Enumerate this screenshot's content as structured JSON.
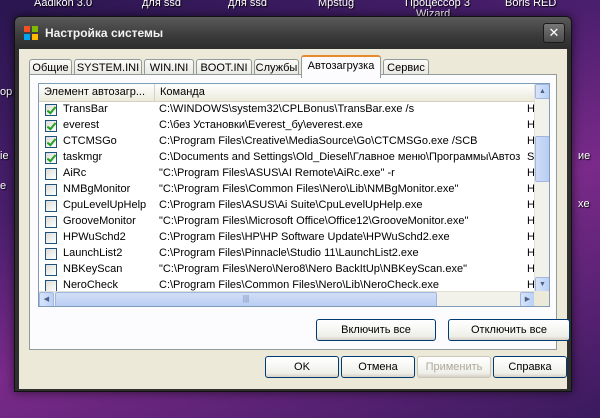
{
  "desktop": {
    "top_labels": [
      "Aadikon 3.0",
      "для ssd",
      "для ssd",
      "Mpstug",
      "Процессор 3",
      "Wizard",
      "Boris RED"
    ],
    "side_labels": [
      "ор",
      "ie",
      "е",
      "ие",
      "xe"
    ]
  },
  "window": {
    "title": "Настройка системы",
    "close_glyph": "✕"
  },
  "tabs": [
    {
      "label": "Общие"
    },
    {
      "label": "SYSTEM.INI"
    },
    {
      "label": "WIN.INI"
    },
    {
      "label": "BOOT.INI"
    },
    {
      "label": "Службы"
    },
    {
      "label": "Автозагрузка",
      "active": true
    },
    {
      "label": "Сервис"
    }
  ],
  "startup_list": {
    "columns": [
      "Элемент автозагр...",
      "Команда"
    ],
    "rows": [
      {
        "checked": true,
        "name": "TransBar",
        "command": "C:\\WINDOWS\\system32\\CPLBonus\\TransBar.exe /s",
        "extra": "H"
      },
      {
        "checked": true,
        "name": "everest",
        "command": "C:\\без Установки\\Everest_бу\\everest.exe",
        "extra": "H"
      },
      {
        "checked": true,
        "name": "CTCMSGo",
        "command": "C:\\Program Files\\Creative\\MediaSource\\Go\\CTCMSGo.exe /SCB",
        "extra": "H"
      },
      {
        "checked": true,
        "name": "taskmgr",
        "command": "C:\\Documents and Settings\\Old_Diesel\\Главное меню\\Программы\\Автоз...",
        "extra": "S"
      },
      {
        "checked": false,
        "name": "AiRc",
        "command": "\"C:\\Program Files\\ASUS\\AI Remote\\AiRc.exe\" -r",
        "extra": "H"
      },
      {
        "checked": false,
        "name": "NMBgMonitor",
        "command": "\"C:\\Program Files\\Common Files\\Nero\\Lib\\NMBgMonitor.exe\"",
        "extra": "H"
      },
      {
        "checked": false,
        "name": "CpuLevelUpHelp",
        "command": "C:\\Program Files\\ASUS\\Ai Suite\\CpuLevelUpHelp.exe",
        "extra": "H"
      },
      {
        "checked": false,
        "name": "GrooveMonitor",
        "command": "\"C:\\Program Files\\Microsoft Office\\Office12\\GrooveMonitor.exe\"",
        "extra": "H"
      },
      {
        "checked": false,
        "name": "HPWuSchd2",
        "command": "C:\\Program Files\\HP\\HP Software Update\\HPWuSchd2.exe",
        "extra": "H"
      },
      {
        "checked": false,
        "name": "LaunchList2",
        "command": "C:\\Program Files\\Pinnacle\\Studio 11\\LaunchList2.exe",
        "extra": "H"
      },
      {
        "checked": false,
        "name": "NBKeyScan",
        "command": "\"C:\\Program Files\\Nero\\Nero8\\Nero BackItUp\\NBKeyScan.exe\"",
        "extra": "H"
      },
      {
        "checked": false,
        "name": "NeroCheck",
        "command": "C:\\Program Files\\Common Files\\Nero\\Lib\\NeroCheck.exe",
        "extra": "H"
      }
    ]
  },
  "buttons": {
    "enable_all": "Включить все",
    "disable_all": "Отключить все",
    "ok": "OK",
    "cancel": "Отмена",
    "apply": "Применить",
    "help": "Справка"
  }
}
